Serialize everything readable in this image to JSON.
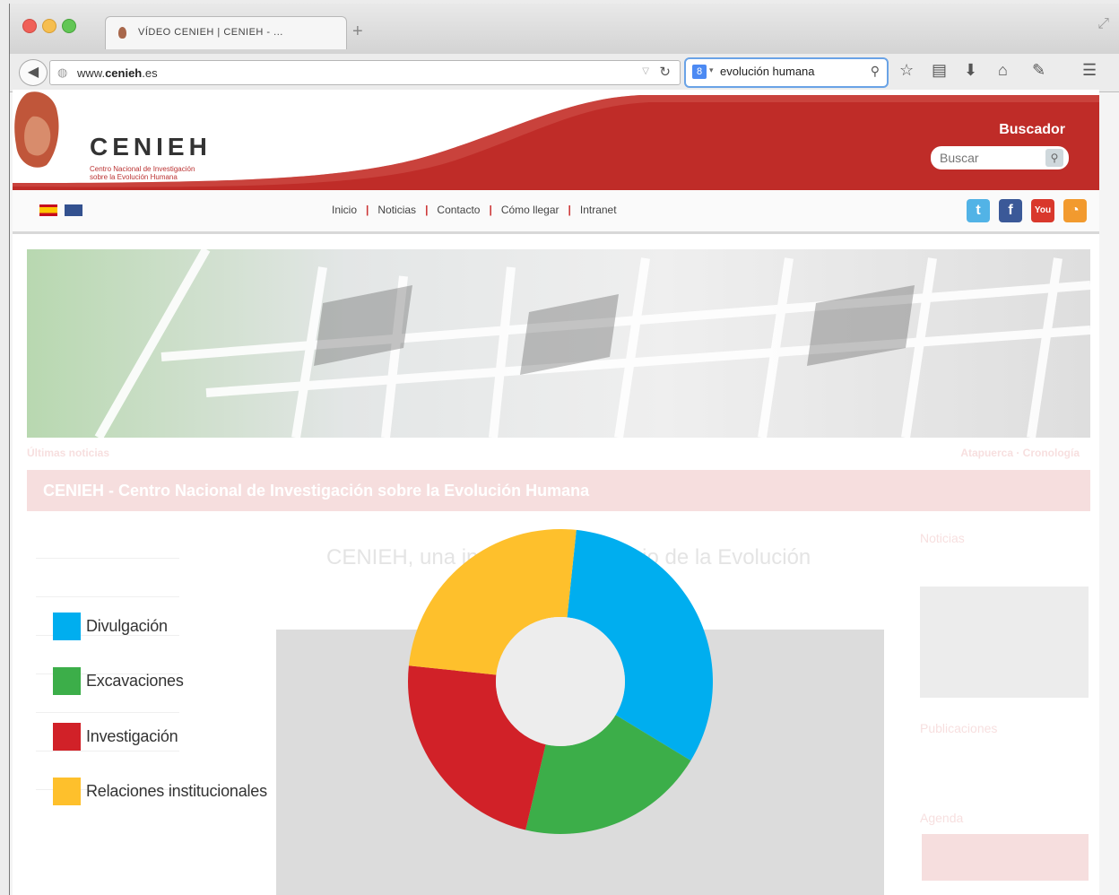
{
  "browser": {
    "tab_title": "VÍDEO CENIEH | CENIEH - ...",
    "new_tab": "+",
    "url_host": "www.",
    "url_domain": "cenieh",
    "url_tld": ".es",
    "search_query": "evolución humana"
  },
  "site": {
    "logo_name": "CENIEH",
    "logo_line1": "Centro Nacional de Investigación",
    "logo_line2": "sobre la Evolución Humana",
    "search_title": "Buscador",
    "search_placeholder": "Buscar",
    "nav": [
      "Inicio",
      "Noticias",
      "Contacto",
      "Cómo llegar",
      "Intranet"
    ],
    "ticker_left": "Últimas noticias",
    "ticker_right": "Atapuerca · Cronología",
    "banner_heading": "CENIEH - Centro Nacional de Investigación sobre la Evolución Humana",
    "main_heading": "CENIEH, una institución al servicio de la Evolución",
    "right_panel": [
      "Noticias",
      "Publicaciones",
      "Agenda"
    ]
  },
  "colors": {
    "divulgacion": "#00aeef",
    "excavaciones": "#3cae49",
    "investigacion": "#d12128",
    "relaciones": "#fec02c",
    "header_red": "#bf2c28"
  },
  "chart_data": {
    "type": "pie",
    "donut": true,
    "title": "",
    "categories": [
      "Divulgación",
      "Excavaciones",
      "Investigación",
      "Relaciones institucionales"
    ],
    "values": [
      32,
      20,
      23,
      25
    ],
    "legend_position": "left"
  }
}
